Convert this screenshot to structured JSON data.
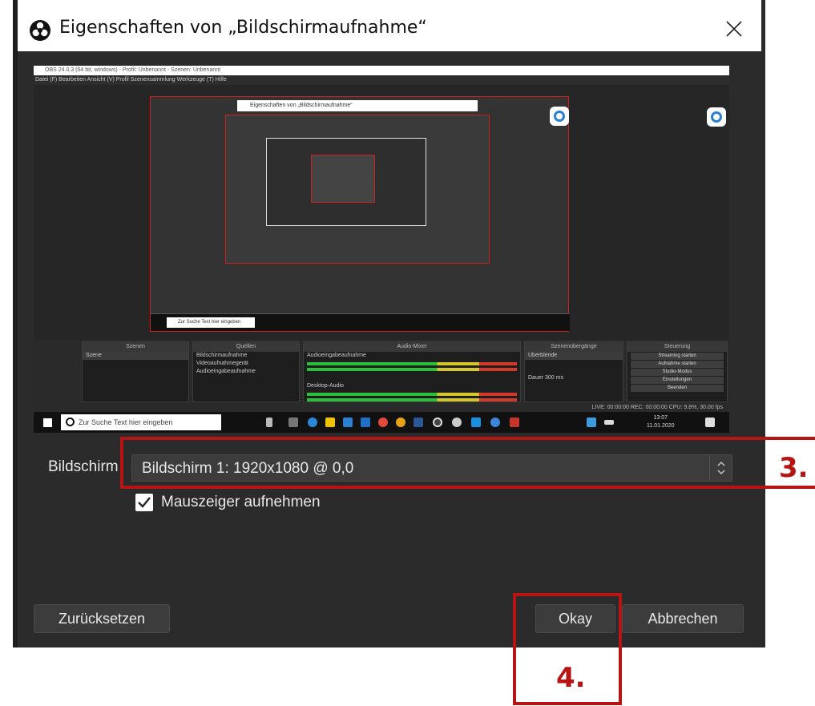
{
  "window": {
    "title": "Eigenschaften von „Bildschirmaufnahme“",
    "app_icon": "obs-logo-icon",
    "close_icon": "close-icon"
  },
  "preview": {
    "obs_title": "OBS 24.0.3 (64 bit, windows) - Profil: Unbenannt - Szenen: Unbenannt",
    "menu": "Datei (F)   Bearbeiten   Ansicht (V)   Profil   Szenensammlung   Werkzeuge (T)   Hilfe",
    "nested_dialog_title": "Eigenschaften von „Bildschirmaufnahme“",
    "docks": {
      "scenes_title": "Szenen",
      "scenes_items": [
        "Szene"
      ],
      "sources_title": "Quellen",
      "sources_items": [
        "Bildschirmaufnahme",
        "Videoaufnahmegerät",
        "Audioeingabeaufnahme"
      ],
      "mixer_title": "Audio-Mixer",
      "mixer_items": [
        "Audioeingabeaufnahme",
        "Desktop-Audio"
      ],
      "transitions_title": "Szenenübergänge",
      "transitions_value": "Überblende",
      "transitions_duration": "Dauer  300 ms",
      "controls_title": "Steuerung",
      "controls_items": [
        "Streaming starten",
        "Aufnahme starten",
        "Studio-Modus",
        "Einstellungen",
        "Beenden"
      ]
    },
    "status": "LIVE: 00:00:00   REC: 00:00:00   CPU: 9.8%, 30.00 fps",
    "taskbar": {
      "search_placeholder": "Zur Suche Text hier eingeben",
      "time": "13:07",
      "date": "11.01.2020"
    }
  },
  "form": {
    "display_label": "Bildschirm",
    "display_value": "Bildschirm 1: 1920x1080 @ 0,0",
    "cursor_checkbox_label": "Mauszeiger aufnehmen",
    "cursor_checked": true
  },
  "buttons": {
    "reset": "Zurücksetzen",
    "ok": "Okay",
    "cancel": "Abbrechen"
  },
  "annotations": {
    "step3": "3.",
    "step4": "4.",
    "color": "#b81414"
  }
}
